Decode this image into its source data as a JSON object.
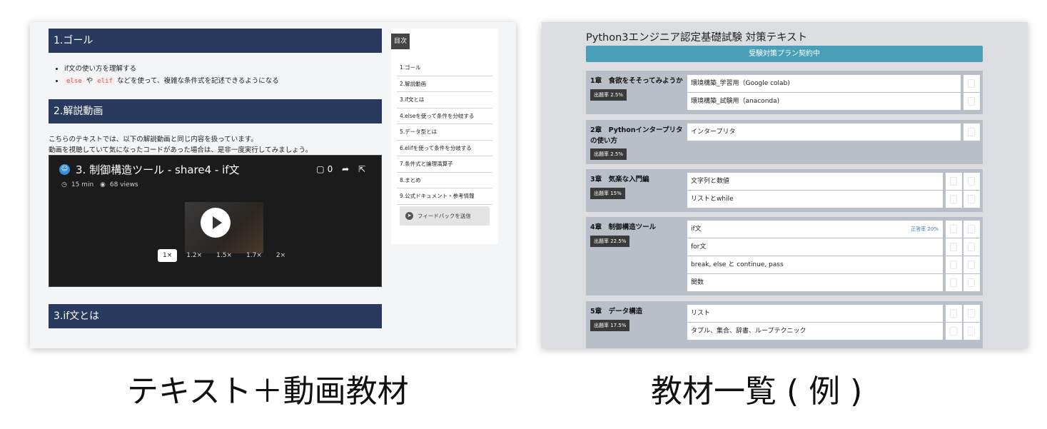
{
  "left": {
    "goal_header": "1.ゴール",
    "goal_items": [
      {
        "pre": "",
        "tag1": "",
        "mid": "",
        "tag2": "",
        "post": "if文の使い方を理解する"
      },
      {
        "pre": "",
        "tag1": "else",
        "mid": " や ",
        "tag2": "elif",
        "post": " などを使って、複雑な条件式を記述できるようになる"
      }
    ],
    "video_header": "2.解説動画",
    "intro_lines": [
      "こちらのテキストでは、以下の解説動画と同じ内容を扱っています。",
      "動画を視聴していて気になったコードがあった場合は、是非一度実行してみましょう。"
    ],
    "video": {
      "title": "3. 制御構造ツール - share4 - if文",
      "duration": "15 min",
      "views": "68 views",
      "comments": "0",
      "speeds": [
        "1×",
        "1.2×",
        "1.5×",
        "1.7×",
        "2×"
      ],
      "active_speed": "1×"
    },
    "if_header": "3.if文とは",
    "toc": {
      "title": "目次",
      "items": [
        "1.ゴール",
        "2.解説動画",
        "3.if文とは",
        "4.elseを使って条件を分岐する",
        "5.データ型とは",
        "6.elifを使って条件を分岐する",
        "7.条件式と論理演算子",
        "8.まとめ",
        "9.公式ドキュメント・参考情報"
      ],
      "feedback": "フィードバックを送信"
    }
  },
  "right": {
    "title": "Python3エンジニア認定基礎試験 対策テキスト",
    "banner": "受験対策プラン契約中",
    "chapters": [
      {
        "name": "1章　食欲をそそってみようか",
        "rate": "出題率 2.5%",
        "lessons": [
          {
            "title": "環境構築_学習用（Google colab)",
            "accuracy": ""
          },
          {
            "title": "環境構築_試験用（anaconda)",
            "accuracy": ""
          }
        ]
      },
      {
        "name": "2章　Pythonインタープリタの使い方",
        "rate": "出題率 2.5%",
        "lessons": [
          {
            "title": "インタープリタ",
            "accuracy": ""
          }
        ]
      },
      {
        "name": "3章　気楽な入門編",
        "rate": "出題率 15%",
        "lessons": [
          {
            "title": "文字列と数値",
            "accuracy": ""
          },
          {
            "title": "リストとwhile",
            "accuracy": ""
          }
        ]
      },
      {
        "name": "4章　制御構造ツール",
        "rate": "出題率 22.5%",
        "lessons": [
          {
            "title": "if文",
            "accuracy": "正答率 20%"
          },
          {
            "title": "for文",
            "accuracy": ""
          },
          {
            "title": "break, else と continue, pass",
            "accuracy": ""
          },
          {
            "title": "関数",
            "accuracy": ""
          }
        ]
      },
      {
        "name": "5章　データ構造",
        "rate": "出題率 17.5%",
        "lessons": [
          {
            "title": "リスト",
            "accuracy": ""
          },
          {
            "title": "タプル、集合、辞書、ループテクニック",
            "accuracy": ""
          }
        ]
      }
    ]
  },
  "captions": {
    "left": "テキスト＋動画教材",
    "right": "教材一覧 ( 例 )"
  }
}
